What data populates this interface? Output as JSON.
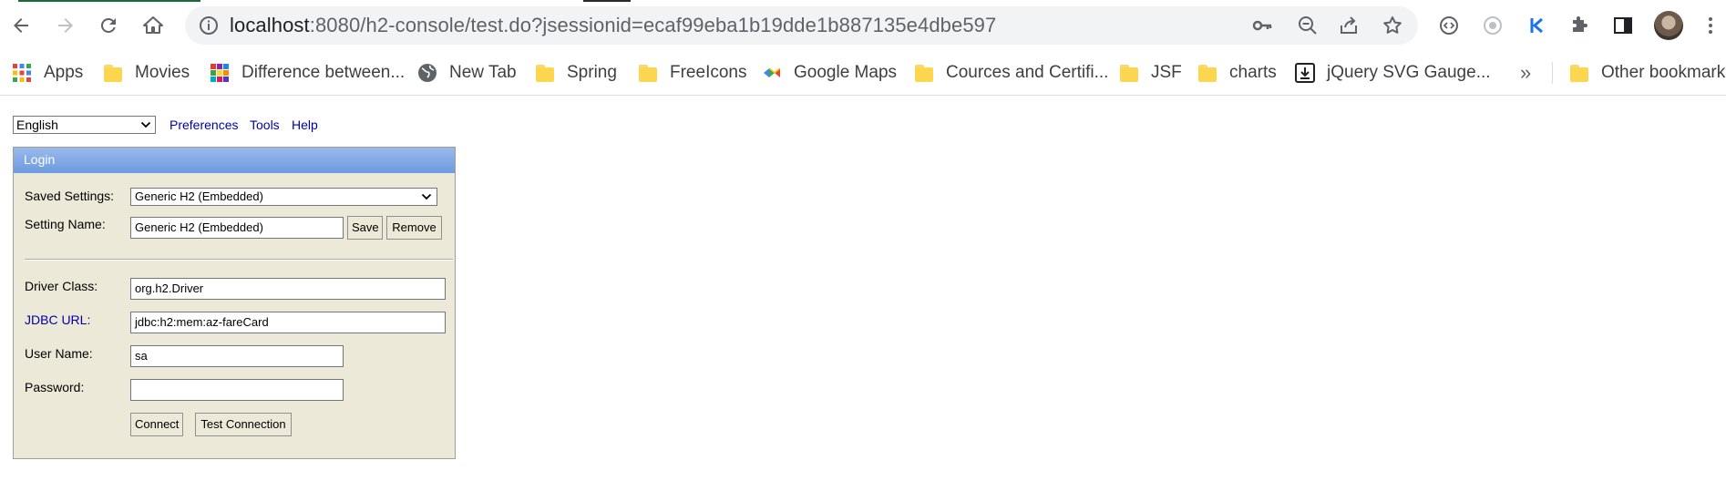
{
  "browser": {
    "url_host": "localhost",
    "url_rest": ":8080/h2-console/test.do?jsessionid=ecaf99eba1b19dde1b887135e4dbe597",
    "bookmarks": [
      {
        "label": "Apps",
        "icon": "apps-grid-icon"
      },
      {
        "label": "Movies",
        "icon": "folder-icon"
      },
      {
        "label": "Difference between...",
        "icon": "grid-favicon"
      },
      {
        "label": "New Tab",
        "icon": "globe-icon"
      },
      {
        "label": "Spring",
        "icon": "folder-icon"
      },
      {
        "label": "FreeIcons",
        "icon": "folder-icon"
      },
      {
        "label": "Google Maps",
        "icon": "maps-icon"
      },
      {
        "label": "Cources and Certifi...",
        "icon": "folder-icon"
      },
      {
        "label": "JSF",
        "icon": "folder-icon"
      },
      {
        "label": "charts",
        "icon": "folder-icon"
      },
      {
        "label": "jQuery SVG Gauge...",
        "icon": "download-icon"
      }
    ],
    "more_label": "»",
    "other_bookmarks": "Other bookmarks"
  },
  "console": {
    "language": "English",
    "links": {
      "preferences": "Preferences",
      "tools": "Tools",
      "help": "Help"
    },
    "login": {
      "title": "Login",
      "saved_settings_label": "Saved Settings:",
      "saved_settings_value": "Generic H2 (Embedded)",
      "setting_name_label": "Setting Name:",
      "setting_name_value": "Generic H2 (Embedded)",
      "save_label": "Save",
      "remove_label": "Remove",
      "driver_class_label": "Driver Class:",
      "driver_class_value": "org.h2.Driver",
      "jdbc_url_label": "JDBC URL:",
      "jdbc_url_value": "jdbc:h2:mem:az-fareCard",
      "user_name_label": "User Name:",
      "user_name_value": "sa",
      "password_label": "Password:",
      "password_value": "",
      "connect_label": "Connect",
      "test_connection_label": "Test Connection"
    }
  },
  "colors": {
    "login_header": "#6c9be0",
    "panel_bg": "#ece9d8",
    "link": "#0000aa"
  }
}
